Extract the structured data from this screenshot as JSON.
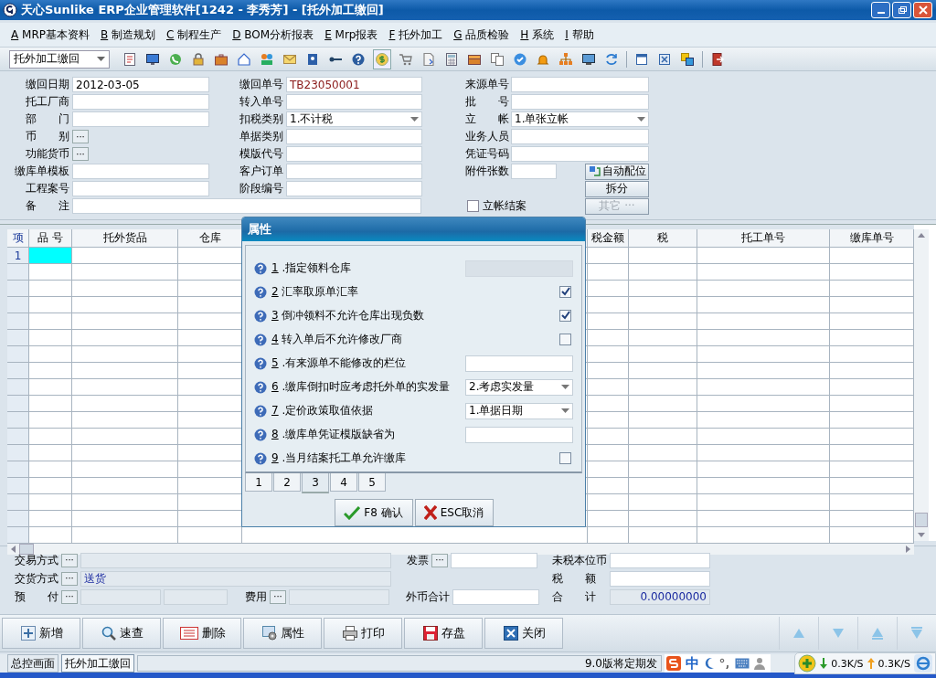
{
  "window": {
    "title": "天心Sunlike ERP企业管理软件[1242 - 李秀芳] - [托外加工缴回]"
  },
  "menu": [
    {
      "key": "A",
      "label": "MRP基本资料"
    },
    {
      "key": "B",
      "label": "制造规划"
    },
    {
      "key": "C",
      "label": "制程生产"
    },
    {
      "key": "D",
      "label": "BOM分析报表"
    },
    {
      "key": "E",
      "label": "Mrp报表"
    },
    {
      "key": "F",
      "label": "托外加工"
    },
    {
      "key": "G",
      "label": "品质检验"
    },
    {
      "key": "H",
      "label": "系统"
    },
    {
      "key": "I",
      "label": "帮助"
    }
  ],
  "toolbar": {
    "combo": "托外加工缴回"
  },
  "header_form": {
    "left": [
      {
        "label": "缴回日期",
        "kind": "text",
        "value": "2012-03-05"
      },
      {
        "label": "托工厂商",
        "kind": "text"
      },
      {
        "label": "部　　门",
        "kind": "text"
      },
      {
        "label": "币　　别",
        "kind": "ellipsis",
        "button": "···"
      },
      {
        "label": "功能货币",
        "kind": "ellipsis",
        "button": "···"
      },
      {
        "label": "缴库单模板",
        "kind": "text"
      },
      {
        "label": "工程案号",
        "kind": "text"
      }
    ],
    "middle": [
      {
        "label": "缴回单号",
        "kind": "text",
        "value": "TB23050001"
      },
      {
        "label": "转入单号",
        "kind": "text"
      },
      {
        "label": "扣税类别",
        "kind": "select",
        "value": "1.不计税"
      },
      {
        "label": "单据类别",
        "kind": "text"
      },
      {
        "label": "模版代号",
        "kind": "text"
      },
      {
        "label": "客户订单",
        "kind": "text"
      },
      {
        "label": "阶段编号",
        "kind": "text"
      }
    ],
    "remark": {
      "label": "备　　注"
    },
    "right": [
      {
        "label": "来源单号",
        "kind": "text"
      },
      {
        "label": "批　　号",
        "kind": "text"
      },
      {
        "label": "立　　帐",
        "kind": "select",
        "value": "1.单张立帐"
      },
      {
        "label": "业务人员",
        "kind": "text"
      },
      {
        "label": "凭证号码",
        "kind": "text"
      },
      {
        "label": "附件张数",
        "kind": "short"
      }
    ],
    "buttons": [
      {
        "label": "自动配位",
        "kind": "auto",
        "disabled": false
      },
      {
        "label": "拆分",
        "kind": "split",
        "disabled": false
      },
      {
        "label": "其它 ···",
        "kind": "other",
        "disabled": true
      }
    ],
    "checkbox": {
      "label": "立帐结案",
      "checked": false
    }
  },
  "table": {
    "columns": [
      {
        "label": "项"
      },
      {
        "label": "品 号"
      },
      {
        "label": "托外货品"
      },
      {
        "label": "仓库"
      },
      {
        "label": "税金额"
      },
      {
        "label": "税"
      },
      {
        "label": "托工单号"
      },
      {
        "label": "缴库单号"
      }
    ],
    "rows": [
      {
        "cells": [
          "1"
        ],
        "selected": true
      }
    ]
  },
  "dialog": {
    "title": "属性",
    "options": [
      {
        "key": "1",
        "label": ".指定领料仓库",
        "kind": "field",
        "disabled": true
      },
      {
        "key": "2",
        "label": "汇率取原单汇率",
        "kind": "checkbox",
        "checked": true
      },
      {
        "key": "3",
        "label": "倒冲领料不允许仓库出现负数",
        "kind": "checkbox",
        "checked": true
      },
      {
        "key": "4",
        "label": "转入单后不允许修改厂商",
        "kind": "checkbox",
        "checked": false
      },
      {
        "key": "5",
        "label": ".有来源单不能修改的栏位",
        "kind": "field",
        "disabled": false
      },
      {
        "key": "6",
        "label": ".缴库倒扣时应考虑托外单的实发量",
        "kind": "select",
        "value": "2.考虑实发量"
      },
      {
        "key": "7",
        "label": ".定价政策取值依据",
        "kind": "select",
        "value": "1.单据日期"
      },
      {
        "key": "8",
        "label": ".缴库单凭证模版缺省为",
        "kind": "field",
        "disabled": false
      },
      {
        "key": "9",
        "label": ".当月结案托工单允许缴库",
        "kind": "checkbox",
        "checked": false
      }
    ],
    "tabs": [
      {
        "label": "1",
        "selected": false
      },
      {
        "label": "2",
        "selected": false
      },
      {
        "label": "3",
        "selected": true
      },
      {
        "label": "4",
        "selected": false
      },
      {
        "label": "5",
        "selected": false
      }
    ],
    "buttons": [
      {
        "label": "F8 确认",
        "kind": "ok"
      },
      {
        "label": "ESC取消",
        "kind": "cancel"
      }
    ]
  },
  "footer": {
    "trade": {
      "label": "交易方式",
      "button": "···"
    },
    "delivery": {
      "label": "交货方式",
      "button": "···",
      "value": "送货"
    },
    "prepay": {
      "label": "预　　付",
      "button": "···"
    },
    "fee": {
      "label": "费用",
      "button": "···"
    },
    "invoice": {
      "label": "发票",
      "button": "···"
    },
    "foreign_total": {
      "label": "外币合计"
    },
    "untaxed": {
      "label": "未税本位币"
    },
    "tax": {
      "label": "税　　额"
    },
    "total": {
      "label": "合　　计",
      "value": "0.00000000"
    }
  },
  "actions": [
    {
      "label": "新增",
      "kind": "add"
    },
    {
      "label": "速查",
      "kind": "search"
    },
    {
      "label": "删除",
      "kind": "delete"
    },
    {
      "label": "属性",
      "kind": "properties"
    },
    {
      "label": "打印",
      "kind": "print"
    },
    {
      "label": "存盘",
      "kind": "save"
    },
    {
      "label": "关闭",
      "kind": "close"
    }
  ],
  "status_bar": {
    "tabs": [
      {
        "label": "总控画面",
        "selected": false
      },
      {
        "label": "托外加工缴回",
        "selected": true
      }
    ],
    "message": "9.0版将定期发",
    "ime": {
      "mode": "中"
    },
    "network": {
      "down": "0.3K/S",
      "up": "0.3K/S"
    }
  }
}
